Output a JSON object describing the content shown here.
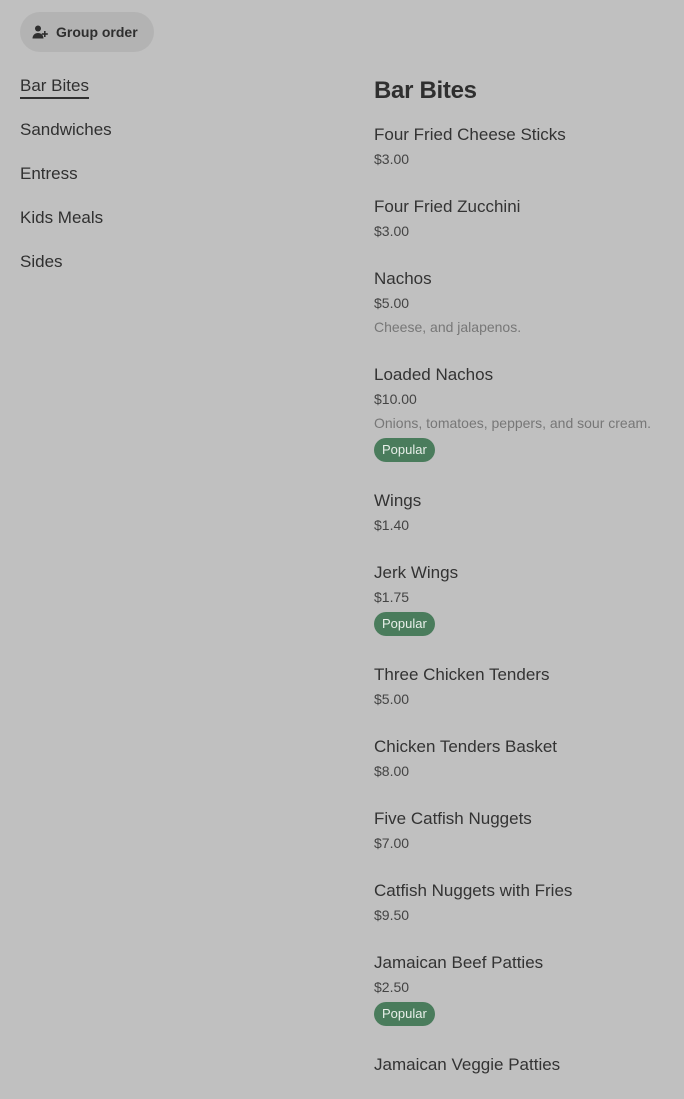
{
  "header": {
    "group_order_label": "Group order",
    "group_order_icon": "add-person-icon"
  },
  "categories": [
    {
      "label": "Bar Bites",
      "active": true
    },
    {
      "label": "Sandwiches",
      "active": false
    },
    {
      "label": "Entress",
      "active": false
    },
    {
      "label": "Kids Meals",
      "active": false
    },
    {
      "label": "Sides",
      "active": false
    }
  ],
  "section": {
    "title": "Bar Bites",
    "items": [
      {
        "name": "Four Fried Cheese Sticks",
        "price": "$3.00",
        "description": "",
        "badge": ""
      },
      {
        "name": "Four Fried Zucchini",
        "price": "$3.00",
        "description": "",
        "badge": ""
      },
      {
        "name": "Nachos",
        "price": "$5.00",
        "description": "Cheese, and jalapenos.",
        "badge": ""
      },
      {
        "name": "Loaded Nachos",
        "price": "$10.00",
        "description": "Onions, tomatoes, peppers, and sour cream.",
        "badge": "Popular"
      },
      {
        "name": "Wings",
        "price": "$1.40",
        "description": "",
        "badge": ""
      },
      {
        "name": "Jerk Wings",
        "price": "$1.75",
        "description": "",
        "badge": "Popular"
      },
      {
        "name": "Three Chicken Tenders",
        "price": "$5.00",
        "description": "",
        "badge": ""
      },
      {
        "name": "Chicken Tenders Basket",
        "price": "$8.00",
        "description": "",
        "badge": ""
      },
      {
        "name": "Five Catfish Nuggets",
        "price": "$7.00",
        "description": "",
        "badge": ""
      },
      {
        "name": "Catfish Nuggets with Fries",
        "price": "$9.50",
        "description": "",
        "badge": ""
      },
      {
        "name": "Jamaican Beef Patties",
        "price": "$2.50",
        "description": "",
        "badge": "Popular"
      },
      {
        "name": "Jamaican Veggie Patties",
        "price": "",
        "description": "",
        "badge": ""
      }
    ]
  },
  "colors": {
    "background": "#c0c0c0",
    "badge": "#4a7c5c"
  }
}
